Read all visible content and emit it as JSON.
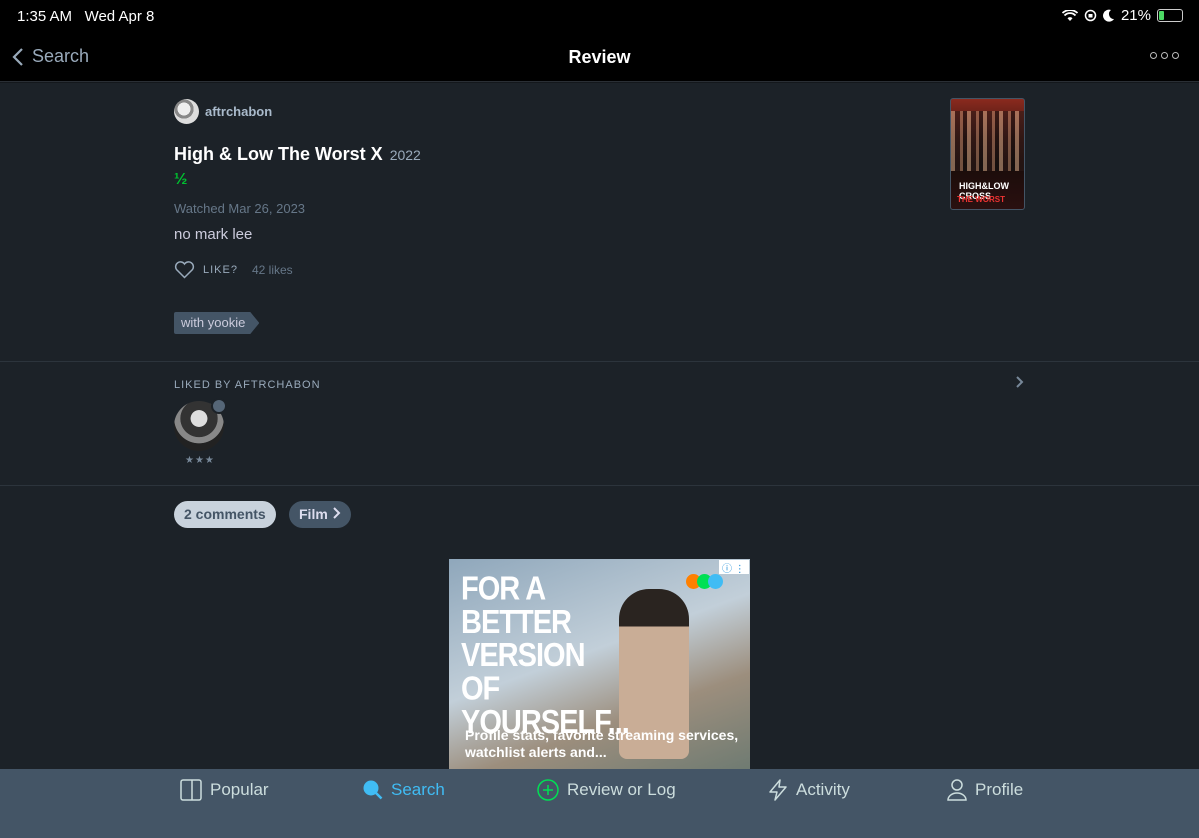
{
  "status_bar": {
    "time": "1:35 AM",
    "date": "Wed Apr 8",
    "battery": "21%",
    "battery_level": 0.21
  },
  "nav": {
    "back_label": "Search",
    "title": "Review"
  },
  "review": {
    "author": "aftrchabon",
    "film_title": "High & Low The Worst X",
    "film_year": "2022",
    "rating": "½",
    "watched": "Watched Mar 26, 2023",
    "text": "no mark lee",
    "like_label": "LIKE?",
    "likes_count": "42 likes",
    "tag": "with yookie",
    "poster_line1": "HIGH&LOW CROSS",
    "poster_line2": "THE WORST"
  },
  "liked_by": {
    "header": "LIKED BY AFTRCHABON",
    "stars": "★★★"
  },
  "pills": {
    "comments": "2 comments",
    "film": "Film"
  },
  "ad": {
    "headline": "FOR A BETTER VERSION OF YOURSELF...",
    "subtext": "Profile stats, favorite streaming services, watchlist alerts and...",
    "dot_colors": [
      "#ff8000",
      "#00e054",
      "#40bcf4"
    ]
  },
  "tabs": [
    {
      "label": "Popular",
      "icon": "popular-icon"
    },
    {
      "label": "Search",
      "icon": "search-icon"
    },
    {
      "label": "Review or Log",
      "icon": "plus-circle-icon"
    },
    {
      "label": "Activity",
      "icon": "lightning-icon"
    },
    {
      "label": "Profile",
      "icon": "profile-icon"
    }
  ],
  "colors": {
    "accent_green": "#00c030",
    "accent_blue": "#40bcf4",
    "tab_bar": "#445566"
  }
}
